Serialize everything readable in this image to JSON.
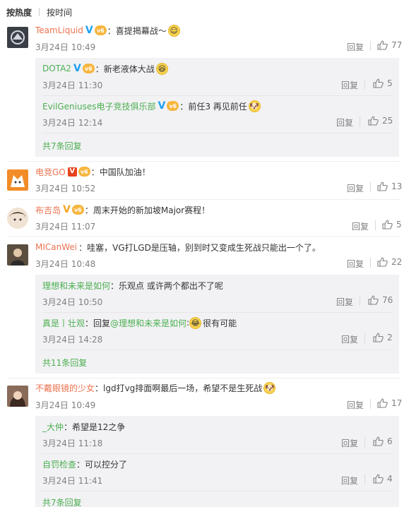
{
  "sort": {
    "hot": "按热度",
    "time": "按时间"
  },
  "labels": {
    "reply": "回复"
  },
  "comments": [
    {
      "user": "TeamLiquid",
      "text": "：喜提揭幕战～",
      "time": "3月24日 10:49",
      "likes": "77",
      "replies": [
        {
          "user": "DOTA2",
          "text": "：新老液体大战",
          "time": "3月24日 11:30",
          "likes": "5"
        },
        {
          "user": "EvilGeniuses电子竞技俱乐部",
          "text": "：前任3 再见前任",
          "time": "3月24日 12:14",
          "likes": "25"
        }
      ],
      "more": "共7条回复"
    },
    {
      "user": "电竞GO",
      "text": "：中国队加油！",
      "time": "3月24日 10:52",
      "likes": "13"
    },
    {
      "user": "布吉岛",
      "text": "：周末开始的新加坡Major赛程！",
      "time": "3月24日 11:07",
      "likes": "5"
    },
    {
      "user": "MICanWei",
      "text": "：哇塞，VG打LGD是压轴，别到时又变成生死战只能出一个了。",
      "time": "3月24日 10:48",
      "likes": "22",
      "replies": [
        {
          "user": "理想和未来是如何",
          "text": "：乐观点 或许两个都出不了呢",
          "time": "3月24日 10:50",
          "likes": "76"
        },
        {
          "user": "真是丨壮观",
          "text": "：回复",
          "mention": "@理想和未来是如何",
          "text2": ":",
          "text3": "很有可能",
          "time": "3月24日 14:28",
          "likes": "2"
        }
      ],
      "more": "共11条回复"
    },
    {
      "user": "不戴眼镜的少女",
      "text": "：lgd打vg排面啊最后一场，希望不是生死战",
      "time": "3月24日 10:49",
      "likes": "17",
      "replies": [
        {
          "user": "_大仲",
          "text": "：希望是12之争",
          "time": "3月24日 11:18",
          "likes": "6"
        },
        {
          "user": "自罚检查",
          "text": "：可以控分了",
          "time": "3月24日 11:41",
          "likes": "4"
        }
      ],
      "more": "共7条回复"
    }
  ]
}
